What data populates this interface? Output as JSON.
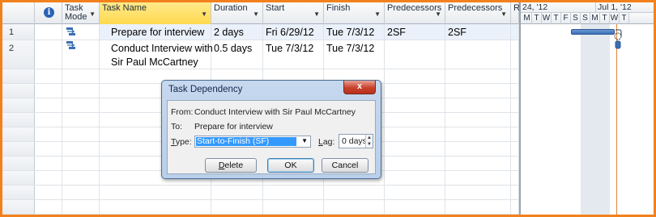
{
  "columns": {
    "info_icon": "i",
    "task_mode": "Task Mode",
    "task_name": "Task Name",
    "duration": "Duration",
    "start": "Start",
    "finish": "Finish",
    "predecessors1": "Predecessors",
    "predecessors2": "Predecessors",
    "extra": "R"
  },
  "tasks": [
    {
      "id": "1",
      "name": "Prepare for interview",
      "duration": "2 days",
      "start": "Fri 6/29/12",
      "finish": "Tue 7/3/12",
      "pred1": "2SF",
      "pred2": "2SF"
    },
    {
      "id": "2",
      "name_line1": "Conduct Interview with",
      "name_line2": "Sir Paul McCartney",
      "duration": "0.5 days",
      "start": "Tue 7/3/12",
      "finish": "Tue 7/3/12",
      "pred1": "",
      "pred2": ""
    }
  ],
  "gantt": {
    "week1": "24, '12",
    "week2": "Jul 1, '12",
    "days": [
      "M",
      "T",
      "W",
      "T",
      "F",
      "S",
      "S",
      "M",
      "T",
      "W",
      "T"
    ]
  },
  "dialog": {
    "title": "Task Dependency",
    "close_glyph": "x",
    "from_label": "From:",
    "from_value": "Conduct Interview with Sir Paul McCartney",
    "to_label": "To:",
    "to_value": "Prepare for interview",
    "type_label_underlined": "T",
    "type_label_rest": "ype:",
    "type_value": "Start-to-Finish (SF)",
    "lag_label_underlined": "L",
    "lag_label_rest": "ag:",
    "lag_value": "0 days",
    "delete_underlined": "D",
    "delete_rest": "elete",
    "ok_label": "OK",
    "cancel_label": "Cancel"
  },
  "colors": {
    "frame": "#f2811d",
    "header_selected": "#ffd94f",
    "gantt_bar": "#3a6fb5",
    "dialog_close": "#c8412c",
    "selection": "#3399ff"
  }
}
